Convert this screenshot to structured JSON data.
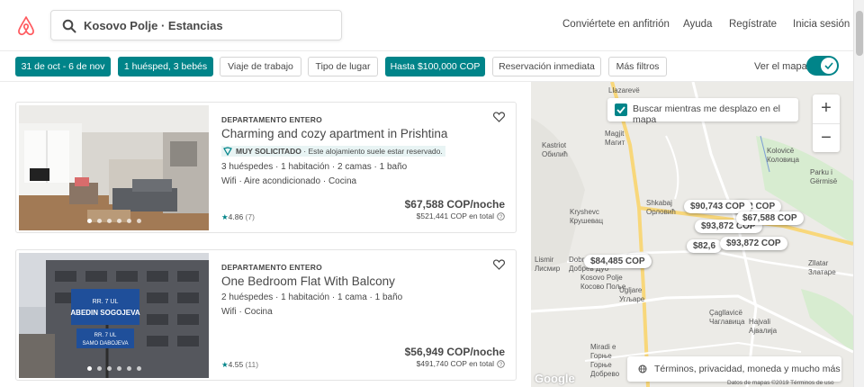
{
  "header": {
    "search_value": "Kosovo Polje · Estancias",
    "nav": [
      "Conviértete en anfitrión",
      "Ayuda",
      "Regístrate",
      "Inicia sesión"
    ]
  },
  "filters": {
    "chips": [
      {
        "label": "31 de oct - 6 de nov",
        "active": true
      },
      {
        "label": "1 huésped, 3 bebés",
        "active": true
      },
      {
        "label": "Viaje de trabajo",
        "active": false
      },
      {
        "label": "Tipo de lugar",
        "active": false
      },
      {
        "label": "Hasta $100,000 COP",
        "active": true
      },
      {
        "label": "Reservación inmediata",
        "active": false
      },
      {
        "label": "Más filtros",
        "active": false
      }
    ],
    "map_toggle_label": "Ver el mapa"
  },
  "listings": [
    {
      "type": "DEPARTAMENTO ENTERO",
      "title": "Charming and cozy apartment in Prishtina",
      "badge_strong": "MUY SOLICITADO",
      "badge_text": " · Este alojamiento suele estar reservado.",
      "details": "3 huéspedes · 1 habitación · 2 camas · 1 baño",
      "amenities": "Wifi · Aire acondicionado · Cocina",
      "rating": "4.86",
      "reviews": "(7)",
      "price": "$67,588 COP/noche",
      "total": "$521,441 COP en total"
    },
    {
      "type": "DEPARTAMENTO ENTERO",
      "title": "One Bedroom Flat With Balcony",
      "details": "2 huéspedes · 1 habitación · 1 cama · 1 baño",
      "amenities": "Wifi · Cocina",
      "rating": "4.55",
      "reviews": "(11)",
      "price": "$56,949 COP/noche",
      "total": "$491,740 COP en total",
      "photo_signs": [
        "RR. 7 UL",
        "ABEDIN SOGOJEVA",
        "RR. 7 UL",
        "SAMO DABOJEVA"
      ]
    }
  ],
  "map": {
    "search_as_move": "Buscar mientras me desplazo en el mapa",
    "zoom_in": "+",
    "zoom_out": "−",
    "pins": [
      "$90,743 COP",
      "$93,872 COP",
      "$67,588 COP",
      "$82,6",
      "$93,872 COP",
      "$84,485 COP",
      "OP",
      "672 COP"
    ],
    "places": [
      "Llazarevë",
      "Kastriot\nОбилић",
      "Magjit\nМагит",
      "Skenderaj?",
      "Shkabaj\nОрловић",
      "Kryshevc\nКрушевац",
      "Kolovicë\nКоловица",
      "Parku i\nGërmisë",
      "Lismir\nЛисмир",
      "Dobrajë\nДобрев Дуб",
      "Kosovo Polje\nКосово Поље",
      "Ugljare\nУгљаре",
      "Çagllavicë\nЧаглавица",
      "Hajvali\nАјвалија",
      "Zllatar\nЗлатаре",
      "Miradi e\nГорње",
      "Горње\nДобрево"
    ],
    "terms_text": "Términos, privacidad, moneda y mucho más",
    "google": "Google",
    "copyright": "Datos de mapas ©2019   Términos de uso"
  },
  "colors": {
    "accent": "#008489",
    "brand": "#FF5A5F"
  }
}
